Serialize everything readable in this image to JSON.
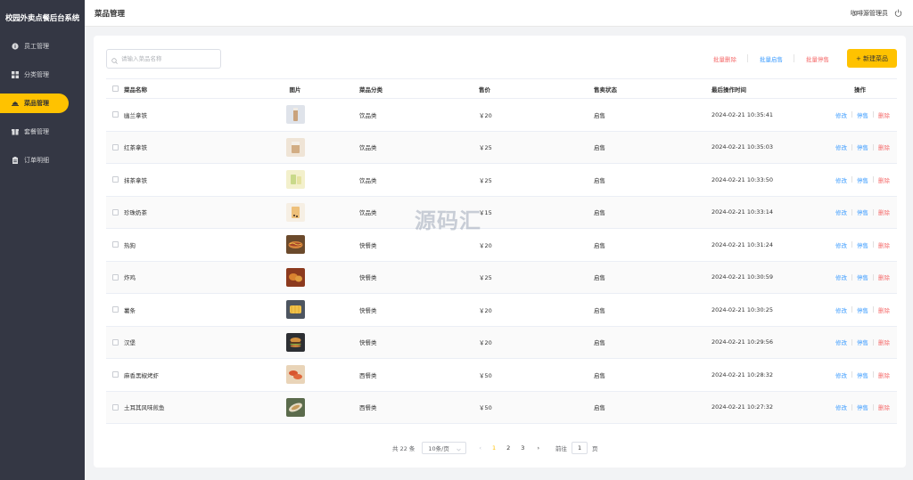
{
  "app": {
    "title": "校园外卖点餐后台系统"
  },
  "sidebar": {
    "items": [
      {
        "label": "员工管理",
        "icon": "employee-icon",
        "active": false
      },
      {
        "label": "分类管理",
        "icon": "category-grid-icon",
        "active": false
      },
      {
        "label": "菜品管理",
        "icon": "dish-cloche-icon",
        "active": true
      },
      {
        "label": "套餐管理",
        "icon": "package-icon",
        "active": false
      },
      {
        "label": "订单明细",
        "icon": "order-clipboard-icon",
        "active": false
      }
    ]
  },
  "header": {
    "title": "菜品管理",
    "user": "咖啡源管理员",
    "logout_icon": "power-icon"
  },
  "toolbar": {
    "search_placeholder": "请输入菜品名称",
    "batch_delete": "批量删除",
    "batch_enable": "批量启售",
    "batch_disable": "批量停售",
    "new_button": "+ 新建菜品"
  },
  "table": {
    "headers": {
      "name": "菜品名称",
      "image": "图片",
      "category": "菜品分类",
      "price": "售价",
      "status": "售卖状态",
      "time": "最后操作时间",
      "actions": "操作"
    },
    "rows": [
      {
        "name": "幽兰拿铁",
        "category": "饮品类",
        "price": "￥20",
        "status": "启售",
        "time": "2024-02-21 10:35:41",
        "thumb": "latte-cup"
      },
      {
        "name": "红茶拿铁",
        "category": "饮品类",
        "price": "￥25",
        "status": "启售",
        "time": "2024-02-21 10:35:03",
        "thumb": "tea-latte"
      },
      {
        "name": "抹茶拿铁",
        "category": "饮品类",
        "price": "￥25",
        "status": "启售",
        "time": "2024-02-21 10:33:50",
        "thumb": "matcha"
      },
      {
        "name": "珍珠奶茶",
        "category": "饮品类",
        "price": "￥15",
        "status": "启售",
        "time": "2024-02-21 10:33:14",
        "thumb": "bubble-tea"
      },
      {
        "name": "热狗",
        "category": "快餐类",
        "price": "￥20",
        "status": "启售",
        "time": "2024-02-21 10:31:24",
        "thumb": "hotdog"
      },
      {
        "name": "炸鸡",
        "category": "快餐类",
        "price": "￥25",
        "status": "启售",
        "time": "2024-02-21 10:30:59",
        "thumb": "fried-chicken"
      },
      {
        "name": "薯条",
        "category": "快餐类",
        "price": "￥20",
        "status": "启售",
        "time": "2024-02-21 10:30:25",
        "thumb": "fries"
      },
      {
        "name": "汉堡",
        "category": "快餐类",
        "price": "￥20",
        "status": "启售",
        "time": "2024-02-21 10:29:56",
        "thumb": "burger"
      },
      {
        "name": "麻香黑椒烤虾",
        "category": "西餐类",
        "price": "￥50",
        "status": "启售",
        "time": "2024-02-21 10:28:32",
        "thumb": "shrimp"
      },
      {
        "name": "土耳其风味煎鱼",
        "category": "西餐类",
        "price": "￥50",
        "status": "启售",
        "time": "2024-02-21 10:27:32",
        "thumb": "fish"
      }
    ],
    "actions": {
      "edit": "修改",
      "stop": "停售",
      "delete": "删除"
    }
  },
  "pagination": {
    "total": "共 22 条",
    "page_size": "10条/页",
    "pages": [
      "1",
      "2",
      "3"
    ],
    "current_page": "1",
    "goto_label": "前往",
    "goto_value": "1",
    "goto_unit": "页"
  },
  "watermark": "源码汇",
  "colors": {
    "accent": "#ffc200",
    "sidebar": "#343744",
    "link": "#409eff",
    "danger": "#f56c6c"
  }
}
